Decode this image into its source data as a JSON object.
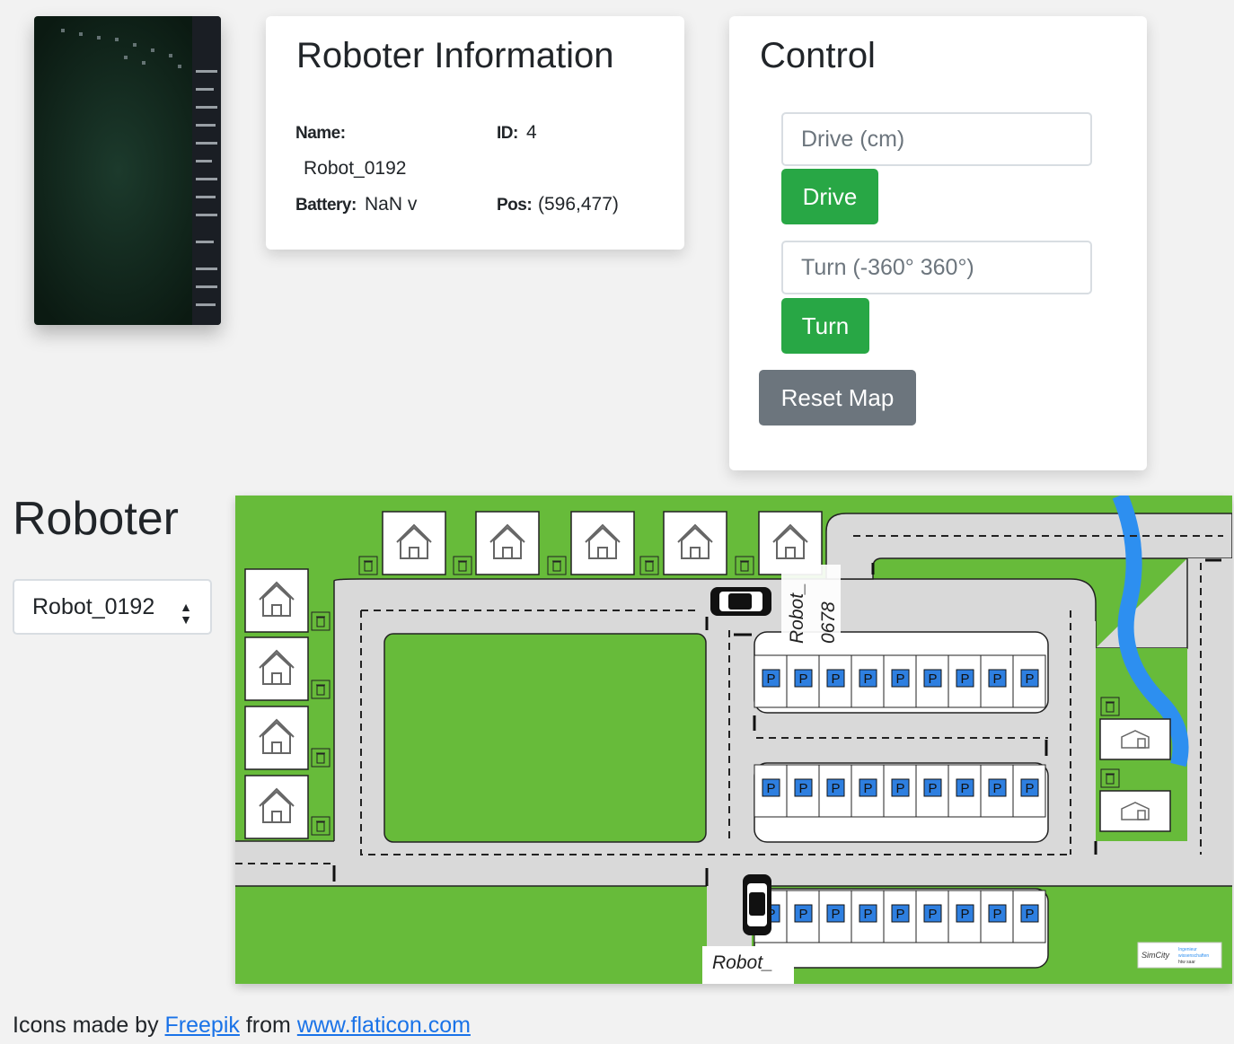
{
  "camera": {
    "icon": "camera-feed-image"
  },
  "info": {
    "title": "Roboter Information",
    "name_label": "Name:",
    "name_value": "Robot_0192",
    "id_label": "ID:",
    "id_value": "4",
    "battery_label": "Battery:",
    "battery_value": "NaN v",
    "pos_label": "Pos:",
    "pos_value": "(596,477)"
  },
  "control": {
    "title": "Control",
    "drive_placeholder": "Drive (cm)",
    "drive_button": "Drive",
    "turn_placeholder": "Turn (-360°  360°)",
    "turn_button": "Turn",
    "reset_button": "Reset Map"
  },
  "roboter": {
    "heading": "Roboter",
    "selected": "Robot_0192"
  },
  "map": {
    "robot_label_1": "Robot_0678",
    "robot_label_1_line1": "Robot_",
    "robot_label_1_line2": "0678",
    "robot_label_2": "Robot_",
    "parking_symbol": "P",
    "logo_text": "SimCity",
    "logo_sub1": "Ingenieur",
    "logo_sub2": "wissenschaften",
    "logo_sub3": "htw saar",
    "colors": {
      "grass": "#67bb3a",
      "road": "#d9d9d9",
      "parking": "#2e7fe0",
      "river": "#2d8ff0"
    }
  },
  "footer": {
    "prefix": "Icons made by ",
    "link1": "Freepik",
    "middle": " from ",
    "link2": "www.flaticon.com"
  }
}
